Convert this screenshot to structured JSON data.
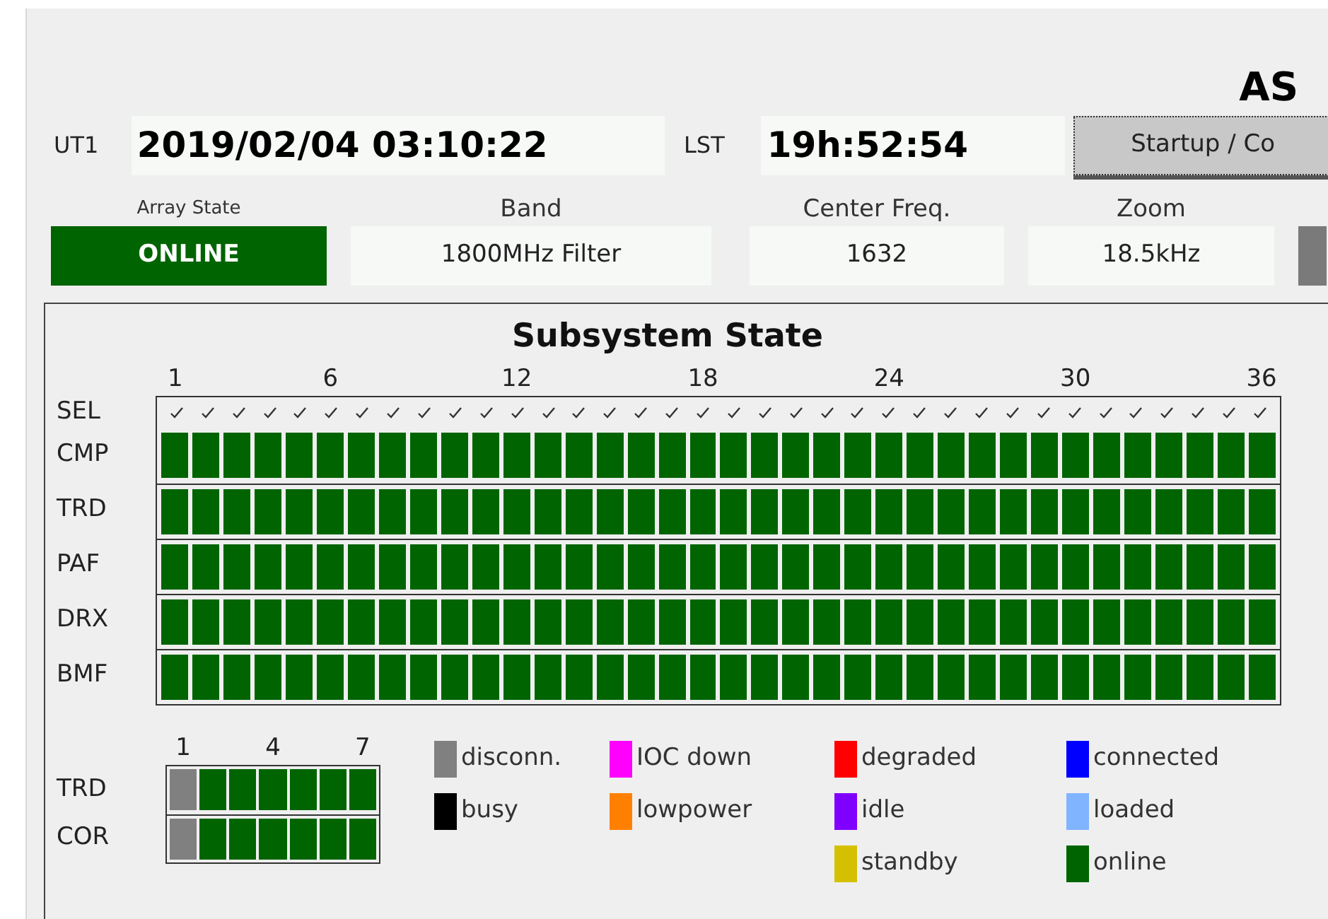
{
  "title": "AS",
  "clock": {
    "ut1_label": "UT1",
    "ut1_value": "2019/02/04 03:10:22",
    "lst_label": "LST",
    "lst_value": "19h:52:54",
    "startup_button": "Startup / Co"
  },
  "status": [
    {
      "label": "Array State",
      "value": "ONLINE",
      "kind": "state",
      "color": "#006400"
    },
    {
      "label": "Band",
      "value": "1800MHz Filter",
      "kind": "field"
    },
    {
      "label": "Center Freq.",
      "value": "1632",
      "kind": "field"
    },
    {
      "label": "Zoom",
      "value": "18.5kHz",
      "kind": "field"
    }
  ],
  "subsystem": {
    "title": "Subsystem State",
    "ticks": [
      "1",
      "6",
      "12",
      "18",
      "24",
      "30",
      "36"
    ],
    "sel_label": "SEL",
    "sel": [
      {
        "checked": true
      },
      {
        "checked": true
      },
      {
        "checked": true
      },
      {
        "checked": true
      },
      {
        "checked": true
      },
      {
        "checked": true
      },
      {
        "checked": true
      },
      {
        "checked": true
      },
      {
        "checked": true
      },
      {
        "checked": true
      },
      {
        "checked": true
      },
      {
        "checked": true
      },
      {
        "checked": true
      },
      {
        "checked": true
      },
      {
        "checked": true
      },
      {
        "checked": true
      },
      {
        "checked": true
      },
      {
        "checked": true
      },
      {
        "checked": true
      },
      {
        "checked": true
      },
      {
        "checked": true
      },
      {
        "checked": true
      },
      {
        "checked": true
      },
      {
        "checked": true
      },
      {
        "checked": true
      },
      {
        "checked": true
      },
      {
        "checked": true
      },
      {
        "checked": true
      },
      {
        "checked": true
      },
      {
        "checked": true
      },
      {
        "checked": true
      },
      {
        "checked": true
      },
      {
        "checked": true
      },
      {
        "checked": true
      },
      {
        "checked": true
      },
      {
        "checked": true
      }
    ],
    "rows": [
      {
        "label": "CMP",
        "cells": [
          {
            "color": "#006400"
          },
          {
            "color": "#006400"
          },
          {
            "color": "#006400"
          },
          {
            "color": "#006400"
          },
          {
            "color": "#006400"
          },
          {
            "color": "#006400"
          },
          {
            "color": "#006400"
          },
          {
            "color": "#006400"
          },
          {
            "color": "#006400"
          },
          {
            "color": "#006400"
          },
          {
            "color": "#006400"
          },
          {
            "color": "#006400"
          },
          {
            "color": "#006400"
          },
          {
            "color": "#006400"
          },
          {
            "color": "#006400"
          },
          {
            "color": "#006400"
          },
          {
            "color": "#006400"
          },
          {
            "color": "#006400"
          },
          {
            "color": "#006400"
          },
          {
            "color": "#006400"
          },
          {
            "color": "#006400"
          },
          {
            "color": "#006400"
          },
          {
            "color": "#006400"
          },
          {
            "color": "#006400"
          },
          {
            "color": "#006400"
          },
          {
            "color": "#006400"
          },
          {
            "color": "#006400"
          },
          {
            "color": "#006400"
          },
          {
            "color": "#006400"
          },
          {
            "color": "#006400"
          },
          {
            "color": "#006400"
          },
          {
            "color": "#006400"
          },
          {
            "color": "#006400"
          },
          {
            "color": "#006400"
          },
          {
            "color": "#006400"
          },
          {
            "color": "#006400"
          }
        ]
      },
      {
        "label": "TRD",
        "cells": [
          {
            "color": "#006400"
          },
          {
            "color": "#006400"
          },
          {
            "color": "#006400"
          },
          {
            "color": "#006400"
          },
          {
            "color": "#006400"
          },
          {
            "color": "#006400"
          },
          {
            "color": "#006400"
          },
          {
            "color": "#006400"
          },
          {
            "color": "#006400"
          },
          {
            "color": "#006400"
          },
          {
            "color": "#006400"
          },
          {
            "color": "#006400"
          },
          {
            "color": "#006400"
          },
          {
            "color": "#006400"
          },
          {
            "color": "#006400"
          },
          {
            "color": "#006400"
          },
          {
            "color": "#006400"
          },
          {
            "color": "#006400"
          },
          {
            "color": "#006400"
          },
          {
            "color": "#006400"
          },
          {
            "color": "#006400"
          },
          {
            "color": "#006400"
          },
          {
            "color": "#006400"
          },
          {
            "color": "#006400"
          },
          {
            "color": "#006400"
          },
          {
            "color": "#006400"
          },
          {
            "color": "#006400"
          },
          {
            "color": "#006400"
          },
          {
            "color": "#006400"
          },
          {
            "color": "#006400"
          },
          {
            "color": "#006400"
          },
          {
            "color": "#006400"
          },
          {
            "color": "#006400"
          },
          {
            "color": "#006400"
          },
          {
            "color": "#006400"
          },
          {
            "color": "#006400"
          }
        ]
      },
      {
        "label": "PAF",
        "cells": [
          {
            "color": "#006400"
          },
          {
            "color": "#006400"
          },
          {
            "color": "#006400"
          },
          {
            "color": "#006400"
          },
          {
            "color": "#006400"
          },
          {
            "color": "#006400"
          },
          {
            "color": "#006400"
          },
          {
            "color": "#006400"
          },
          {
            "color": "#006400"
          },
          {
            "color": "#006400"
          },
          {
            "color": "#006400"
          },
          {
            "color": "#006400"
          },
          {
            "color": "#006400"
          },
          {
            "color": "#006400"
          },
          {
            "color": "#006400"
          },
          {
            "color": "#006400"
          },
          {
            "color": "#006400"
          },
          {
            "color": "#006400"
          },
          {
            "color": "#006400"
          },
          {
            "color": "#006400"
          },
          {
            "color": "#006400"
          },
          {
            "color": "#006400"
          },
          {
            "color": "#006400"
          },
          {
            "color": "#006400"
          },
          {
            "color": "#006400"
          },
          {
            "color": "#006400"
          },
          {
            "color": "#006400"
          },
          {
            "color": "#006400"
          },
          {
            "color": "#006400"
          },
          {
            "color": "#006400"
          },
          {
            "color": "#006400"
          },
          {
            "color": "#006400"
          },
          {
            "color": "#006400"
          },
          {
            "color": "#006400"
          },
          {
            "color": "#006400"
          },
          {
            "color": "#006400"
          }
        ]
      },
      {
        "label": "DRX",
        "cells": [
          {
            "color": "#006400"
          },
          {
            "color": "#006400"
          },
          {
            "color": "#006400"
          },
          {
            "color": "#006400"
          },
          {
            "color": "#006400"
          },
          {
            "color": "#006400"
          },
          {
            "color": "#006400"
          },
          {
            "color": "#006400"
          },
          {
            "color": "#006400"
          },
          {
            "color": "#006400"
          },
          {
            "color": "#006400"
          },
          {
            "color": "#006400"
          },
          {
            "color": "#006400"
          },
          {
            "color": "#006400"
          },
          {
            "color": "#006400"
          },
          {
            "color": "#006400"
          },
          {
            "color": "#006400"
          },
          {
            "color": "#006400"
          },
          {
            "color": "#006400"
          },
          {
            "color": "#006400"
          },
          {
            "color": "#006400"
          },
          {
            "color": "#006400"
          },
          {
            "color": "#006400"
          },
          {
            "color": "#006400"
          },
          {
            "color": "#006400"
          },
          {
            "color": "#006400"
          },
          {
            "color": "#006400"
          },
          {
            "color": "#006400"
          },
          {
            "color": "#006400"
          },
          {
            "color": "#006400"
          },
          {
            "color": "#006400"
          },
          {
            "color": "#006400"
          },
          {
            "color": "#006400"
          },
          {
            "color": "#006400"
          },
          {
            "color": "#006400"
          },
          {
            "color": "#006400"
          }
        ]
      },
      {
        "label": "BMF",
        "cells": [
          {
            "color": "#006400"
          },
          {
            "color": "#006400"
          },
          {
            "color": "#006400"
          },
          {
            "color": "#006400"
          },
          {
            "color": "#006400"
          },
          {
            "color": "#006400"
          },
          {
            "color": "#006400"
          },
          {
            "color": "#006400"
          },
          {
            "color": "#006400"
          },
          {
            "color": "#006400"
          },
          {
            "color": "#006400"
          },
          {
            "color": "#006400"
          },
          {
            "color": "#006400"
          },
          {
            "color": "#006400"
          },
          {
            "color": "#006400"
          },
          {
            "color": "#006400"
          },
          {
            "color": "#006400"
          },
          {
            "color": "#006400"
          },
          {
            "color": "#006400"
          },
          {
            "color": "#006400"
          },
          {
            "color": "#006400"
          },
          {
            "color": "#006400"
          },
          {
            "color": "#006400"
          },
          {
            "color": "#006400"
          },
          {
            "color": "#006400"
          },
          {
            "color": "#006400"
          },
          {
            "color": "#006400"
          },
          {
            "color": "#006400"
          },
          {
            "color": "#006400"
          },
          {
            "color": "#006400"
          },
          {
            "color": "#006400"
          },
          {
            "color": "#006400"
          },
          {
            "color": "#006400"
          },
          {
            "color": "#006400"
          },
          {
            "color": "#006400"
          },
          {
            "color": "#006400"
          }
        ]
      }
    ]
  },
  "small_grid": {
    "ticks": [
      "1",
      "4",
      "7"
    ],
    "rows": [
      {
        "label": "TRD",
        "cells": [
          {
            "color": "#808080"
          },
          {
            "color": "#006400"
          },
          {
            "color": "#006400"
          },
          {
            "color": "#006400"
          },
          {
            "color": "#006400"
          },
          {
            "color": "#006400"
          },
          {
            "color": "#006400"
          }
        ]
      },
      {
        "label": "COR",
        "cells": [
          {
            "color": "#808080"
          },
          {
            "color": "#006400"
          },
          {
            "color": "#006400"
          },
          {
            "color": "#006400"
          },
          {
            "color": "#006400"
          },
          {
            "color": "#006400"
          },
          {
            "color": "#006400"
          }
        ]
      }
    ]
  },
  "legend": [
    [
      {
        "label": "disconn.",
        "color": "#808080"
      },
      {
        "label": "busy",
        "color": "#000000"
      }
    ],
    [
      {
        "label": "IOC down",
        "color": "#ff00ff"
      },
      {
        "label": "lowpower",
        "color": "#ff8000"
      }
    ],
    [
      {
        "label": "degraded",
        "color": "#ff0000"
      },
      {
        "label": "idle",
        "color": "#8000ff"
      },
      {
        "label": "standby",
        "color": "#d4c000"
      }
    ],
    [
      {
        "label": "connected",
        "color": "#0000ff"
      },
      {
        "label": "loaded",
        "color": "#80b4ff"
      },
      {
        "label": "online",
        "color": "#006400"
      }
    ]
  ]
}
